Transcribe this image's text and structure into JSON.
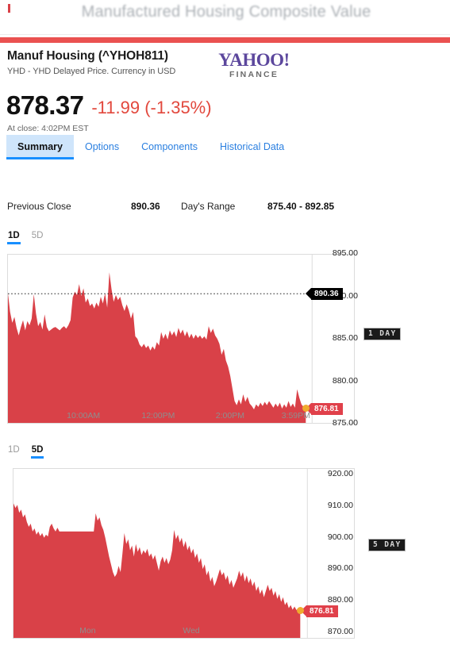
{
  "browser": {
    "page_title": "Manufactured Housing Composite Value"
  },
  "quote": {
    "name": "Manuf Housing (^YHOH811)",
    "subtitle": "YHD - YHD Delayed Price. Currency in USD",
    "price": "878.37",
    "change": "-11.99 (-1.35%)",
    "market_time": "At close: 4:02PM EST",
    "change_color": "#e2483d"
  },
  "logo": {
    "word": "YAHOO!",
    "finance": "FINANCE",
    "word_color": "#5c479d"
  },
  "tabs": [
    {
      "label": "Summary",
      "active": true
    },
    {
      "label": "Options",
      "active": false
    },
    {
      "label": "Components",
      "active": false
    },
    {
      "label": "Historical Data",
      "active": false
    }
  ],
  "stats": {
    "previous_close_label": "Previous Close",
    "previous_close_value": "890.36",
    "days_range_label": "Day's Range",
    "days_range_value": "875.40 - 892.85"
  },
  "chart_one": {
    "range_options": [
      {
        "label": "1D",
        "active": true
      },
      {
        "label": "5D",
        "active": false
      }
    ],
    "badge": "1 DAY"
  },
  "chart_two": {
    "range_options": [
      {
        "label": "1D",
        "active": false
      },
      {
        "label": "5D",
        "active": true
      }
    ],
    "badge": "5 DAY"
  },
  "chart_data": [
    {
      "id": "intraday-1d",
      "type": "area",
      "title": "1 DAY",
      "xlabel": "",
      "ylabel": "",
      "grid": false,
      "legend": false,
      "line_color": "#d94148",
      "fill_color": "#d94148",
      "ylim": [
        875.0,
        895.0
      ],
      "yticks": [
        "895.00",
        "890.00",
        "885.00",
        "880.00",
        "875.00"
      ],
      "ytick_values": [
        895.0,
        890.0,
        885.0,
        880.0,
        875.0
      ],
      "xticks": [
        "10:00AM",
        "12:00PM",
        "2:00PM",
        "3:59PM"
      ],
      "xtick_positions": [
        0.255,
        0.505,
        0.745,
        0.965
      ],
      "previous_close_line": 890.36,
      "previous_close_label": "890.36",
      "last_price": 876.81,
      "last_price_label": "876.81",
      "marker_color": "#f0ab2e",
      "values": [
        890.4,
        888.2,
        886.9,
        887.6,
        886.3,
        885.4,
        886.4,
        887.2,
        886.0,
        887.1,
        886.6,
        887.4,
        890.3,
        888.0,
        886.5,
        887.0,
        886.1,
        887.9,
        886.4,
        885.9,
        886.1,
        886.3,
        886.4,
        886.2,
        886.0,
        886.3,
        886.5,
        886.2,
        886.6,
        887.2,
        889.9,
        890.6,
        890.2,
        891.5,
        890.1,
        891.0,
        889.3,
        889.8,
        888.9,
        889.2,
        888.6,
        889.3,
        888.8,
        890.0,
        889.2,
        890.4,
        888.7,
        892.9,
        890.9,
        889.4,
        890.2,
        889.6,
        890.0,
        889.0,
        888.3,
        889.1,
        888.4,
        887.4,
        888.2,
        885.3,
        885.0,
        884.3,
        884.0,
        884.4,
        883.9,
        884.2,
        883.6,
        884.1,
        883.7,
        884.6,
        884.2,
        885.8,
        885.0,
        885.6,
        884.9,
        886.0,
        885.4,
        885.9,
        885.2,
        886.3,
        885.6,
        886.1,
        885.3,
        885.9,
        885.1,
        885.6,
        885.0,
        885.5,
        885.1,
        885.4,
        885.0,
        885.3,
        884.9,
        886.5,
        885.7,
        886.2,
        885.4,
        885.0,
        884.4,
        883.1,
        883.8,
        882.4,
        881.7,
        880.6,
        879.1,
        877.6,
        877.1,
        877.8,
        877.2,
        878.4,
        877.5,
        878.1,
        877.3,
        877.0,
        876.6,
        877.2,
        876.9,
        877.4,
        877.0,
        877.5,
        877.1,
        877.6,
        877.2,
        876.8,
        877.3,
        876.9,
        877.4,
        876.7,
        877.2,
        876.8,
        877.6,
        876.9,
        877.3,
        876.8,
        879.0,
        878.0,
        877.2,
        876.9,
        876.81
      ]
    },
    {
      "id": "intraday-5d",
      "type": "area",
      "title": "5 DAY",
      "xlabel": "",
      "ylabel": "",
      "grid": false,
      "legend": false,
      "line_color": "#d94148",
      "fill_color": "#d94148",
      "ylim": [
        868.0,
        922.0
      ],
      "yticks": [
        "920.00",
        "910.00",
        "900.00",
        "890.00",
        "880.00",
        "870.00"
      ],
      "ytick_values": [
        920.0,
        910.0,
        900.0,
        890.0,
        880.0,
        870.0
      ],
      "xticks": [
        "Mon",
        "Wed"
      ],
      "xtick_positions": [
        0.26,
        0.62
      ],
      "last_price": 876.81,
      "last_price_label": "876.81",
      "marker_color": "#f0ab2e",
      "values": [
        911.0,
        909.5,
        910.5,
        908.0,
        909.0,
        906.5,
        907.5,
        905.0,
        903.5,
        904.5,
        902.0,
        903.0,
        901.0,
        902.0,
        900.5,
        901.5,
        900.0,
        901.0,
        900.4,
        903.5,
        904.5,
        903.0,
        902.0,
        903.2,
        902.0,
        902.0,
        902.0,
        902.0,
        902.0,
        902.0,
        902.0,
        902.0,
        902.0,
        902.0,
        902.0,
        902.0,
        902.0,
        902.0,
        902.0,
        902.0,
        902.0,
        902.0,
        902.0,
        907.8,
        905.5,
        906.5,
        904.0,
        902.5,
        900.0,
        897.0,
        894.0,
        891.5,
        889.0,
        887.5,
        888.5,
        891.0,
        889.0,
        895.0,
        901.5,
        898.0,
        899.5,
        896.0,
        897.5,
        894.0,
        898.0,
        895.5,
        897.0,
        894.5,
        896.0,
        895.0,
        896.5,
        894.0,
        895.0,
        893.0,
        894.5,
        892.0,
        889.5,
        892.5,
        894.0,
        892.0,
        893.5,
        891.5,
        893.0,
        896.0,
        902.5,
        899.5,
        901.0,
        898.5,
        900.0,
        897.0,
        899.0,
        896.0,
        897.5,
        895.0,
        896.5,
        893.5,
        895.0,
        892.0,
        893.5,
        890.0,
        891.5,
        888.0,
        889.5,
        886.0,
        887.5,
        884.5,
        886.0,
        888.0,
        890.0,
        888.0,
        889.0,
        886.5,
        888.0,
        885.0,
        886.5,
        884.0,
        885.5,
        887.0,
        889.5,
        887.5,
        889.0,
        886.0,
        888.0,
        885.5,
        887.0,
        884.5,
        886.0,
        883.0,
        884.5,
        882.0,
        883.5,
        881.0,
        883.0,
        885.0,
        883.0,
        884.0,
        881.5,
        883.0,
        880.5,
        882.0,
        879.5,
        881.0,
        878.5,
        879.5,
        877.5,
        878.5,
        877.0,
        878.0,
        876.9,
        877.5,
        876.81
      ]
    }
  ]
}
